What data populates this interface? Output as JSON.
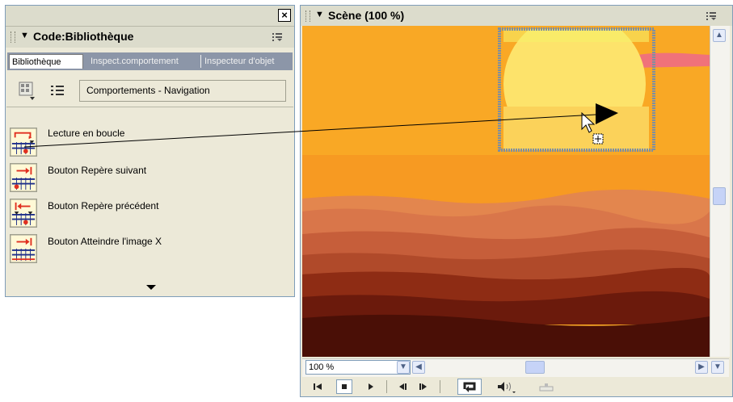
{
  "library": {
    "title": "Code:Bibliothèque",
    "close_glyph": "×",
    "tabs": [
      "Bibliothèque",
      "Inspect.comportement",
      "Inspecteur d'objet"
    ],
    "category": "Comportements - Navigation",
    "items": [
      {
        "label": "Lecture en boucle",
        "icon": "loop-behavior-icon"
      },
      {
        "label": "Bouton Repère suivant",
        "icon": "next-marker-icon"
      },
      {
        "label": "Bouton Repère précédent",
        "icon": "previous-marker-icon"
      },
      {
        "label": "Bouton Atteindre l'image X",
        "icon": "goto-frame-icon"
      }
    ]
  },
  "stage": {
    "title": "Scène (100 %)",
    "zoom": "100 %"
  },
  "colors": {
    "panel_bg": "#ece9d8",
    "tab_bar": "#8c96a8",
    "sky": "#f9a825",
    "sun": "#fde36b"
  }
}
